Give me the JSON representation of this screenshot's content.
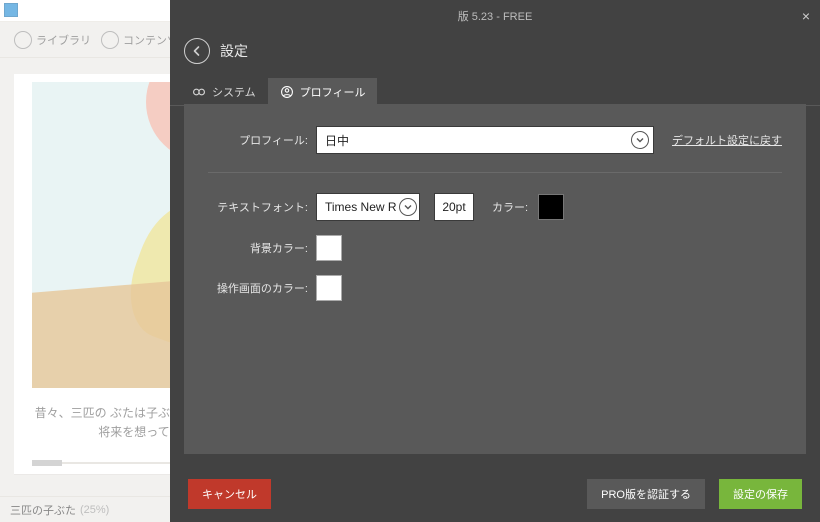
{
  "app": {
    "toolbar": {
      "library": "ライブラリ",
      "contents": "コンテンツ"
    },
    "story_preview": "昔々、三匹の\nぶたは子ぶたを育\nたの将来を想って",
    "status": {
      "title": "三匹の子ぶた",
      "progress": "(25%)"
    }
  },
  "modal": {
    "version_line": "版 5.23 - FREE",
    "title": "設定",
    "tabs": {
      "system": "システム",
      "profile": "プロフィール"
    },
    "profile": {
      "label": "プロフィール:",
      "value": "日中",
      "reset": "デフォルト設定に戻す"
    },
    "font": {
      "label": "テキストフォント:",
      "family": "Times New R",
      "size": "20pt",
      "color_label": "カラー:"
    },
    "bg_color_label": "背景カラー:",
    "ui_color_label": "操作画面のカラー:",
    "buttons": {
      "cancel": "キャンセル",
      "recognize_pro": "PRO版を認証する",
      "save": "設定の保存"
    },
    "colors": {
      "text_color": "#000000",
      "bg_color": "#ffffff",
      "ui_color": "#ffffff"
    }
  }
}
